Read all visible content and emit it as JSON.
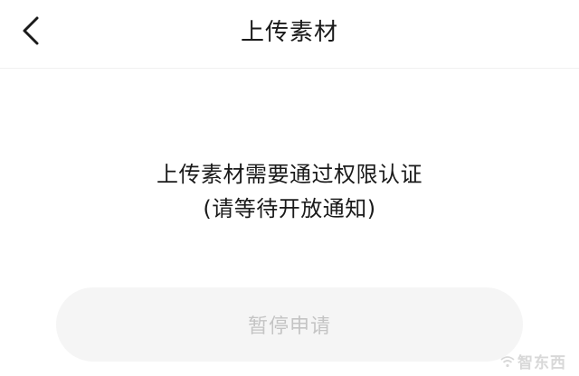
{
  "header": {
    "title": "上传素材"
  },
  "message": {
    "line1": "上传素材需要通过权限认证",
    "line2": "(请等待开放通知)"
  },
  "actions": {
    "pause_label": "暂停申请"
  },
  "watermark": {
    "text": "智东西"
  },
  "colors": {
    "background": "#ffffff",
    "text": "#1a1a1a",
    "button_bg": "#f5f5f5",
    "button_text": "#c4c4c4"
  }
}
